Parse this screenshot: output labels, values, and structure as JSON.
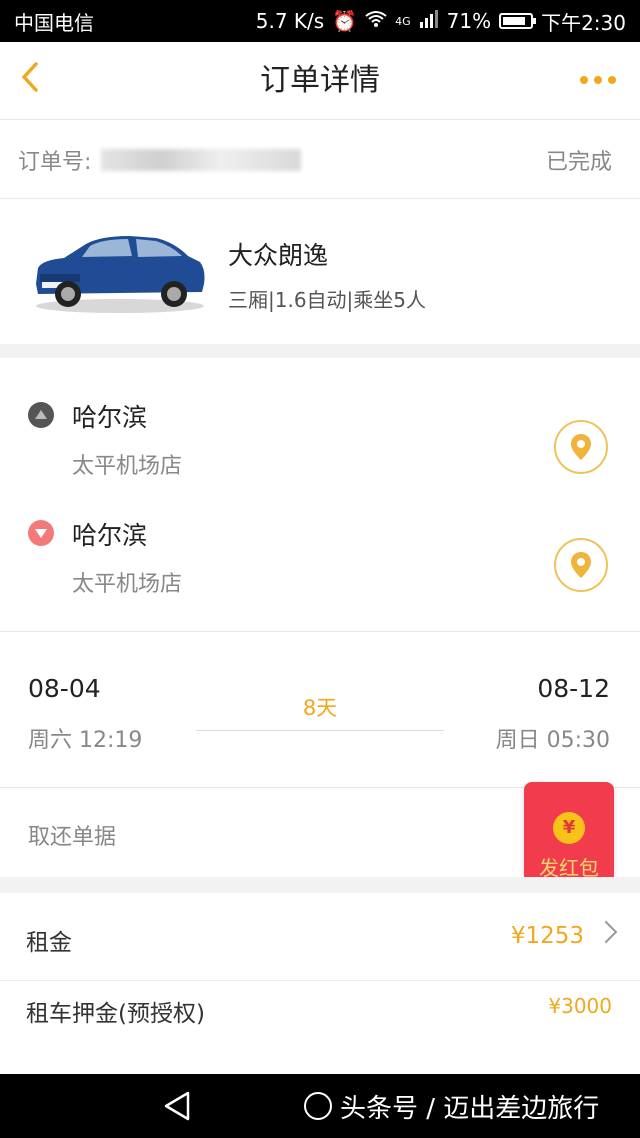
{
  "statusbar": {
    "carrier": "中国电信",
    "speed": "5.7 K/s",
    "network": "4G",
    "battery": "71%",
    "time": "下午2:30"
  },
  "nav": {
    "title": "订单详情",
    "back_icon": "chevron-left-icon",
    "more_icon": "more-dots-icon"
  },
  "order": {
    "label": "订单号:",
    "status": "已完成"
  },
  "car": {
    "name": "大众朗逸",
    "spec": "三厢|1.6自动|乘坐5人"
  },
  "pickup": {
    "city": "哈尔滨",
    "store": "太平机场店"
  },
  "return": {
    "city": "哈尔滨",
    "store": "太平机场店"
  },
  "rental_period": {
    "start_date": "08-04",
    "start_time": "周六 12:19",
    "days": "8天",
    "end_date": "08-12",
    "end_time": "周日 05:30"
  },
  "receipt": {
    "label": "取还单据"
  },
  "red_packet": {
    "coin": "¥",
    "label": "发红包"
  },
  "fees": {
    "rent_label": "租金",
    "rent_value": "¥1253",
    "deposit_label": "租车押金(预授权)",
    "deposit_value": "¥3000"
  },
  "watermark": "头条号 / 迈出差边旅行",
  "colors": {
    "accent": "#f0a81e",
    "red_packet": "#f23b4d",
    "pickup_dot": "#555555",
    "return_dot": "#f47a7a"
  }
}
